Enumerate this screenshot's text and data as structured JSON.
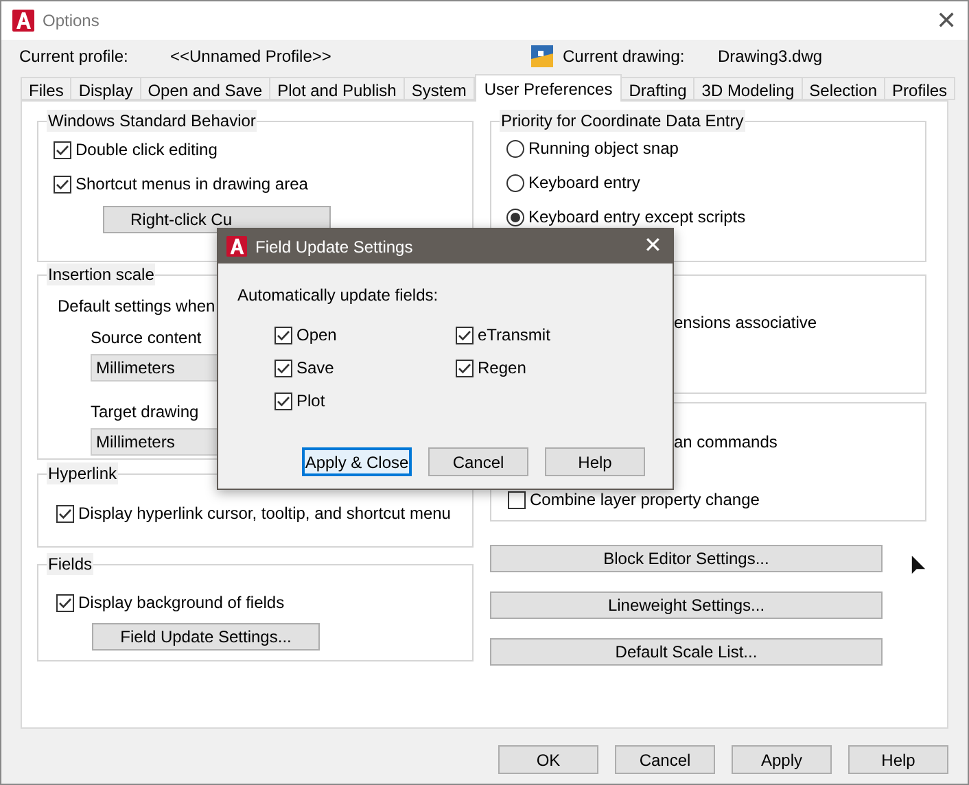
{
  "window": {
    "title": "Options",
    "close": "✕"
  },
  "profile": {
    "label": "Current profile:",
    "value": "<<Unnamed Profile>>"
  },
  "drawing": {
    "label": "Current drawing:",
    "value": "Drawing3.dwg"
  },
  "tabs": [
    {
      "label": "Files",
      "selected": false
    },
    {
      "label": "Display",
      "selected": false
    },
    {
      "label": "Open and Save",
      "selected": false
    },
    {
      "label": "Plot and Publish",
      "selected": false
    },
    {
      "label": "System",
      "selected": false
    },
    {
      "label": "User Preferences",
      "selected": true
    },
    {
      "label": "Drafting",
      "selected": false
    },
    {
      "label": "3D Modeling",
      "selected": false
    },
    {
      "label": "Selection",
      "selected": false
    },
    {
      "label": "Profiles",
      "selected": false
    }
  ],
  "windows_behavior": {
    "title": "Windows Standard Behavior",
    "options": [
      {
        "label": "Double click editing",
        "checked": true
      },
      {
        "label": "Shortcut menus in drawing area",
        "checked": true
      }
    ],
    "button": "Right-click Cu"
  },
  "insertion_scale": {
    "title": "Insertion scale",
    "note": "Default settings when",
    "source_label": "Source content",
    "source_value": "Millimeters",
    "target_label": "Target drawing",
    "target_value": "Millimeters"
  },
  "hyperlink": {
    "title": "Hyperlink",
    "option": {
      "label": "Display hyperlink cursor, tooltip, and shortcut menu",
      "checked": true
    }
  },
  "fields": {
    "title": "Fields",
    "option": {
      "label": "Display background of fields",
      "checked": true
    },
    "button": "Field Update Settings..."
  },
  "priority": {
    "title": "Priority for Coordinate Data Entry",
    "options": [
      {
        "label": "Running object snap",
        "selected": false
      },
      {
        "label": "Keyboard entry",
        "selected": false
      },
      {
        "label": "Keyboard entry except scripts",
        "selected": true
      }
    ]
  },
  "associative": {
    "text": "ensions associative"
  },
  "undo": {
    "text": "an commands",
    "option": {
      "label": "Combine layer property change",
      "checked": false
    }
  },
  "side_buttons": [
    "Block Editor Settings...",
    "Lineweight Settings...",
    "Default Scale List..."
  ],
  "footer_buttons": [
    "OK",
    "Cancel",
    "Apply",
    "Help"
  ],
  "dialog": {
    "title": "Field Update Settings",
    "close": "✕",
    "prompt": "Automatically update fields:",
    "options": [
      {
        "label": "Open",
        "checked": true
      },
      {
        "label": "Save",
        "checked": true
      },
      {
        "label": "Plot",
        "checked": true
      },
      {
        "label": "eTransmit",
        "checked": true
      },
      {
        "label": "Regen",
        "checked": true
      }
    ],
    "buttons": [
      {
        "label": "Apply & Close",
        "selected": true
      },
      {
        "label": "Cancel",
        "selected": false
      },
      {
        "label": "Help",
        "selected": false
      }
    ]
  }
}
